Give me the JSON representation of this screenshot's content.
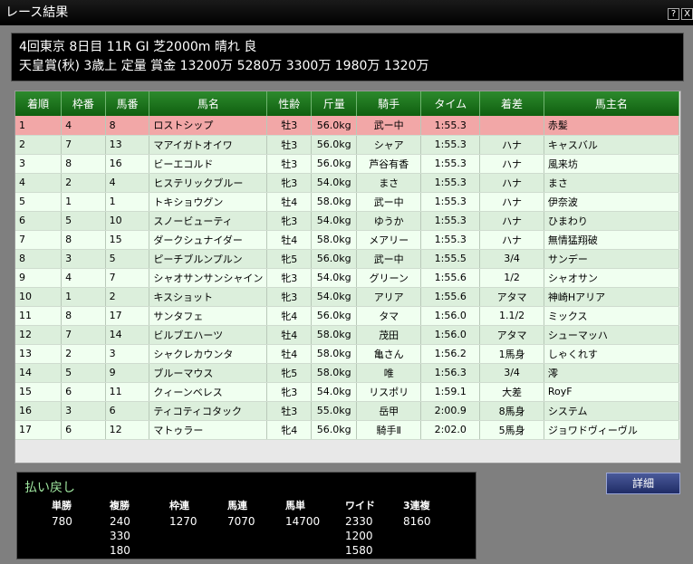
{
  "window": {
    "title": "レース結果",
    "help_btn": "?",
    "close_btn": "X"
  },
  "race": {
    "line1": "4回東京 8日目 11R GⅠ 芝2000m 晴れ 良",
    "line2": "天皇賞(秋) 3歳上 定量 賞金 13200万 5280万 3300万 1980万 1320万"
  },
  "table": {
    "headers": [
      "着順",
      "枠番",
      "馬番",
      "馬名",
      "性齢",
      "斤量",
      "騎手",
      "タイム",
      "着差",
      "馬主名"
    ],
    "rows": [
      [
        "1",
        "4",
        "8",
        "ロストシップ",
        "牡3",
        "56.0kg",
        "武ー中",
        "1:55.3",
        "",
        "赤髪"
      ],
      [
        "2",
        "7",
        "13",
        "マアイガトオイワ",
        "牡3",
        "56.0kg",
        "シャア",
        "1:55.3",
        "ハナ",
        "キャスバル"
      ],
      [
        "3",
        "8",
        "16",
        "ビーエコルド",
        "牡3",
        "56.0kg",
        "芦谷有香",
        "1:55.3",
        "ハナ",
        "風来坊"
      ],
      [
        "4",
        "2",
        "4",
        "ヒステリックブルー",
        "牝3",
        "54.0kg",
        "まさ",
        "1:55.3",
        "ハナ",
        "まさ"
      ],
      [
        "5",
        "1",
        "1",
        "トキショウグン",
        "牡4",
        "58.0kg",
        "武ー中",
        "1:55.3",
        "ハナ",
        "伊奈波"
      ],
      [
        "6",
        "5",
        "10",
        "スノービューティ",
        "牝3",
        "54.0kg",
        "ゆうか",
        "1:55.3",
        "ハナ",
        "ひまわり"
      ],
      [
        "7",
        "8",
        "15",
        "ダークシュナイダー",
        "牡4",
        "58.0kg",
        "メアリー",
        "1:55.3",
        "ハナ",
        "無情猛翔破"
      ],
      [
        "8",
        "3",
        "5",
        "ピーチブルンプルン",
        "牝5",
        "56.0kg",
        "武ー中",
        "1:55.5",
        "3/4",
        "サンデー"
      ],
      [
        "9",
        "4",
        "7",
        "シャオサンサンシャイン",
        "牝3",
        "54.0kg",
        "グリーン",
        "1:55.6",
        "1/2",
        "シャオサン"
      ],
      [
        "10",
        "1",
        "2",
        "キスショット",
        "牝3",
        "54.0kg",
        "アリア",
        "1:55.6",
        "アタマ",
        "神崎Hアリア"
      ],
      [
        "11",
        "8",
        "17",
        "サンタフェ",
        "牝4",
        "56.0kg",
        "タマ",
        "1:56.0",
        "1.1/2",
        "ミックス"
      ],
      [
        "12",
        "7",
        "14",
        "ビルブエハーツ",
        "牡4",
        "58.0kg",
        "茂田",
        "1:56.0",
        "アタマ",
        "シューマッハ"
      ],
      [
        "13",
        "2",
        "3",
        "シャクレカウンタ",
        "牡4",
        "58.0kg",
        "亀さん",
        "1:56.2",
        "1馬身",
        "しゃくれす"
      ],
      [
        "14",
        "5",
        "9",
        "ブルーマウス",
        "牝5",
        "58.0kg",
        "唯",
        "1:56.3",
        "3/4",
        "澪"
      ],
      [
        "15",
        "6",
        "11",
        "クィーンベレス",
        "牝3",
        "54.0kg",
        "リスポリ",
        "1:59.1",
        "大差",
        "RoyF"
      ],
      [
        "16",
        "3",
        "6",
        "ティコティコタック",
        "牡3",
        "55.0kg",
        "岳甲",
        "2:00.9",
        "8馬身",
        "システム"
      ],
      [
        "17",
        "6",
        "12",
        "マトゥラー",
        "牝4",
        "56.0kg",
        "騎手Ⅱ",
        "2:02.0",
        "5馬身",
        "ジョワドヴィーヴル"
      ]
    ]
  },
  "payout": {
    "title": "払い戻し",
    "columns": [
      {
        "label": "単勝",
        "values": [
          "780"
        ]
      },
      {
        "label": "複勝",
        "values": [
          "240",
          "330",
          "180"
        ]
      },
      {
        "label": "枠連",
        "values": [
          "1270"
        ]
      },
      {
        "label": "馬連",
        "values": [
          "7070"
        ]
      },
      {
        "label": "馬単",
        "values": [
          "14700"
        ]
      },
      {
        "label": "ワイド",
        "values": [
          "2330",
          "1200",
          "1580"
        ]
      },
      {
        "label": "3連複",
        "values": [
          "8160"
        ]
      }
    ]
  },
  "detail_button": "詳細",
  "colors": {
    "header_green": "#1a6f1a",
    "highlight_row": "#f2a7a7",
    "row_light": "#f0fff0",
    "row_alt": "#dcefdc",
    "payout_title": "#9fe69f"
  }
}
